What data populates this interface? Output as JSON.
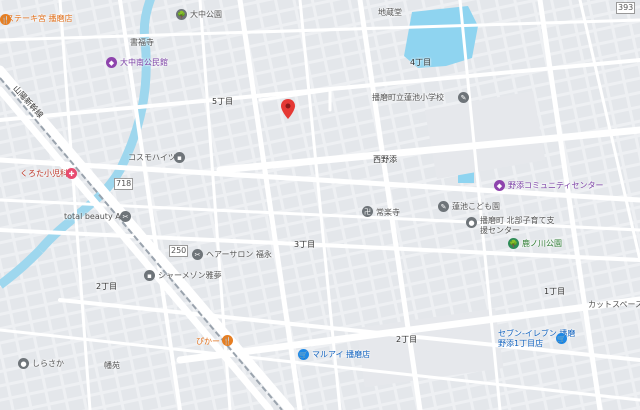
{
  "map": {
    "labels": {
      "steak": "ステーキ宮 播磨店",
      "oonaka_park": "大中公園",
      "shofukuji": "書福寺",
      "kominkan": "大中南公民館",
      "kinshi": "地蔵堂",
      "chome4": "4丁目",
      "chome5": "5丁目",
      "hasuike_school": "播磨町立蓮池小学校",
      "nishinojo": "西野添",
      "kosumo": "コスモハイツ",
      "kurota": "くろた小児科",
      "community": "野添コミュニティセンター",
      "total_beauty": "total beauty Ami",
      "kokaido": "常楽寺",
      "hasuike_kodomo": "蓮池こども園",
      "support_center": "播磨町 北部子育て支援センター",
      "chome3": "3丁目",
      "hair_salon": "ヘアーサロン 福永",
      "mainogawa_park": "鹿ノ川公園",
      "chome2a": "2丁目",
      "sharmen": "シャーメゾン雅夢",
      "chome1": "1丁目",
      "cutspace": "カットスペースI",
      "chome2b": "2丁目",
      "seven": "セブン-イレブン 播磨野添1丁目店",
      "pika": "ぴかー",
      "marui": "マルアイ 播磨店",
      "shirasaka": "しらさか",
      "hata": "幡苑",
      "sanyo": "山陽新幹線",
      "road_250": "250",
      "road_718": "718",
      "road_393": "393"
    }
  }
}
